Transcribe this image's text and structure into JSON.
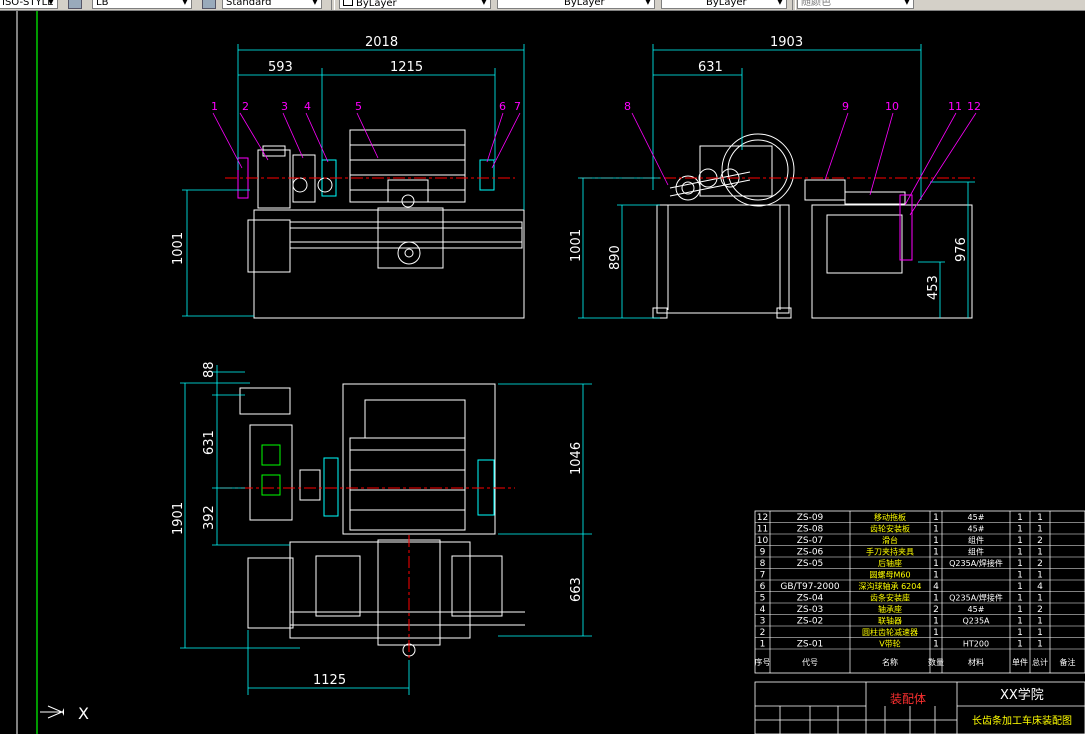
{
  "toolbar": {
    "textstyle": "ISO-STYLE",
    "dimstyle": "LB",
    "tablestyle": "Standard",
    "layer_color": "ByLayer",
    "linetype": "ByLayer",
    "lineweight": "ByLayer",
    "plotstyle": "随颜色"
  },
  "views": {
    "front": {
      "dims": [
        "2018",
        "593",
        "1215",
        "1001"
      ],
      "balloons": [
        "1",
        "2",
        "3",
        "4",
        "5",
        "6",
        "7"
      ]
    },
    "side": {
      "dims": [
        "1903",
        "631",
        "1001",
        "890",
        "976",
        "453"
      ],
      "balloons": [
        "8",
        "9",
        "10",
        "11",
        "12"
      ]
    },
    "top": {
      "dims": [
        "88",
        "631",
        "1046",
        "1901",
        "392",
        "663",
        "1125"
      ]
    }
  },
  "bom": {
    "rows": [
      {
        "no": "12",
        "code": "ZS-09",
        "name": "移动拖板",
        "qty": "1",
        "material": "45#",
        "w1": "1",
        "w2": "1"
      },
      {
        "no": "11",
        "code": "ZS-08",
        "name": "齿轮安装板",
        "qty": "1",
        "material": "45#",
        "w1": "1",
        "w2": "1"
      },
      {
        "no": "10",
        "code": "ZS-07",
        "name": "滑台",
        "qty": "1",
        "material": "组件",
        "w1": "1",
        "w2": "2"
      },
      {
        "no": "9",
        "code": "ZS-06",
        "name": "手刀夹持夹具",
        "qty": "1",
        "material": "组件",
        "w1": "1",
        "w2": "1"
      },
      {
        "no": "8",
        "code": "ZS-05",
        "name": "后轴座",
        "qty": "1",
        "material": "Q235A/焊接件",
        "w1": "1",
        "w2": "2"
      },
      {
        "no": "7",
        "code": "",
        "name": "圆螺母M60",
        "qty": "1",
        "material": "",
        "w1": "1",
        "w2": "1"
      },
      {
        "no": "6",
        "code": "GB/T97-2000",
        "name": "深沟球轴承 6204",
        "qty": "4",
        "material": "",
        "w1": "1",
        "w2": "4"
      },
      {
        "no": "5",
        "code": "ZS-04",
        "name": "齿条安装座",
        "qty": "1",
        "material": "Q235A/焊接件",
        "w1": "1",
        "w2": "1"
      },
      {
        "no": "4",
        "code": "ZS-03",
        "name": "轴承座",
        "qty": "2",
        "material": "45#",
        "w1": "1",
        "w2": "2"
      },
      {
        "no": "3",
        "code": "ZS-02",
        "name": "联轴器",
        "qty": "1",
        "material": "Q235A",
        "w1": "1",
        "w2": "1"
      },
      {
        "no": "2",
        "code": "",
        "name": "圆柱齿轮减速器",
        "qty": "1",
        "material": "",
        "w1": "1",
        "w2": "1"
      },
      {
        "no": "1",
        "code": "ZS-01",
        "name": "V带轮",
        "qty": "1",
        "material": "HT200",
        "w1": "1",
        "w2": "1"
      }
    ],
    "header": {
      "no": "序号",
      "code": "代号",
      "name": "名称",
      "qty": "数量",
      "material": "材料",
      "w1": "单件",
      "w2": "总计",
      "note": "备注"
    }
  },
  "title_block": {
    "drawing_name": "装配体",
    "school": "XX学院",
    "subtitle": "长齿条加工车床装配图"
  },
  "ucs": {
    "x_label": "X"
  },
  "colors": {
    "background": "#000000",
    "outline": "#ffffff",
    "dimension": "#00ffff",
    "leader": "#ff00ff",
    "centerline": "#ff0000",
    "green": "#00ff00",
    "title_red": "#ff3030",
    "title_yellow": "#ffff00"
  }
}
